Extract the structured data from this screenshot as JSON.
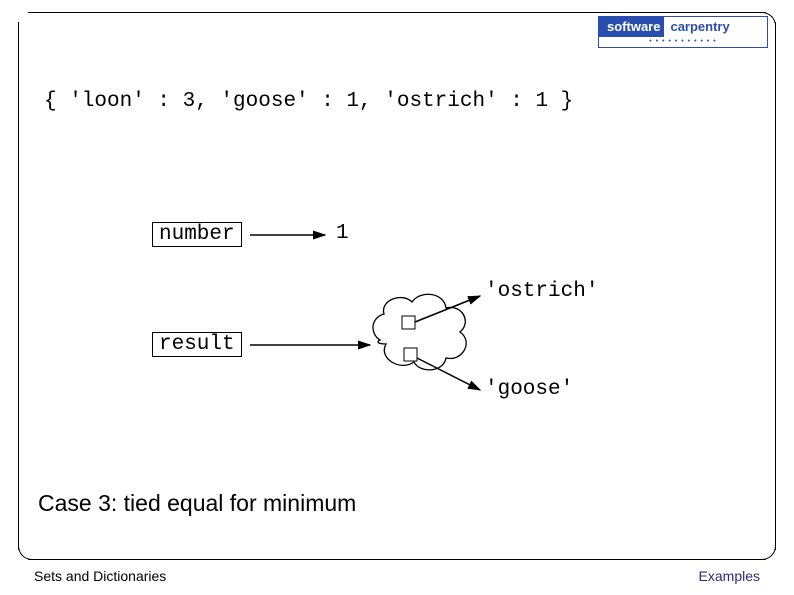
{
  "logo": {
    "left": "software",
    "right": "carpentry",
    "sub": "• • • • • • • • • • •"
  },
  "code": "{ 'loon' : 3, 'goose' : 1, 'ostrich' : 1 }",
  "labels": {
    "number": "number",
    "result": "result",
    "one": "1",
    "ostrich": "'ostrich'",
    "goose": "'goose'"
  },
  "caption": "Case 3: tied equal for minimum",
  "footer": {
    "left": "Sets and Dictionaries",
    "right": "Examples"
  }
}
